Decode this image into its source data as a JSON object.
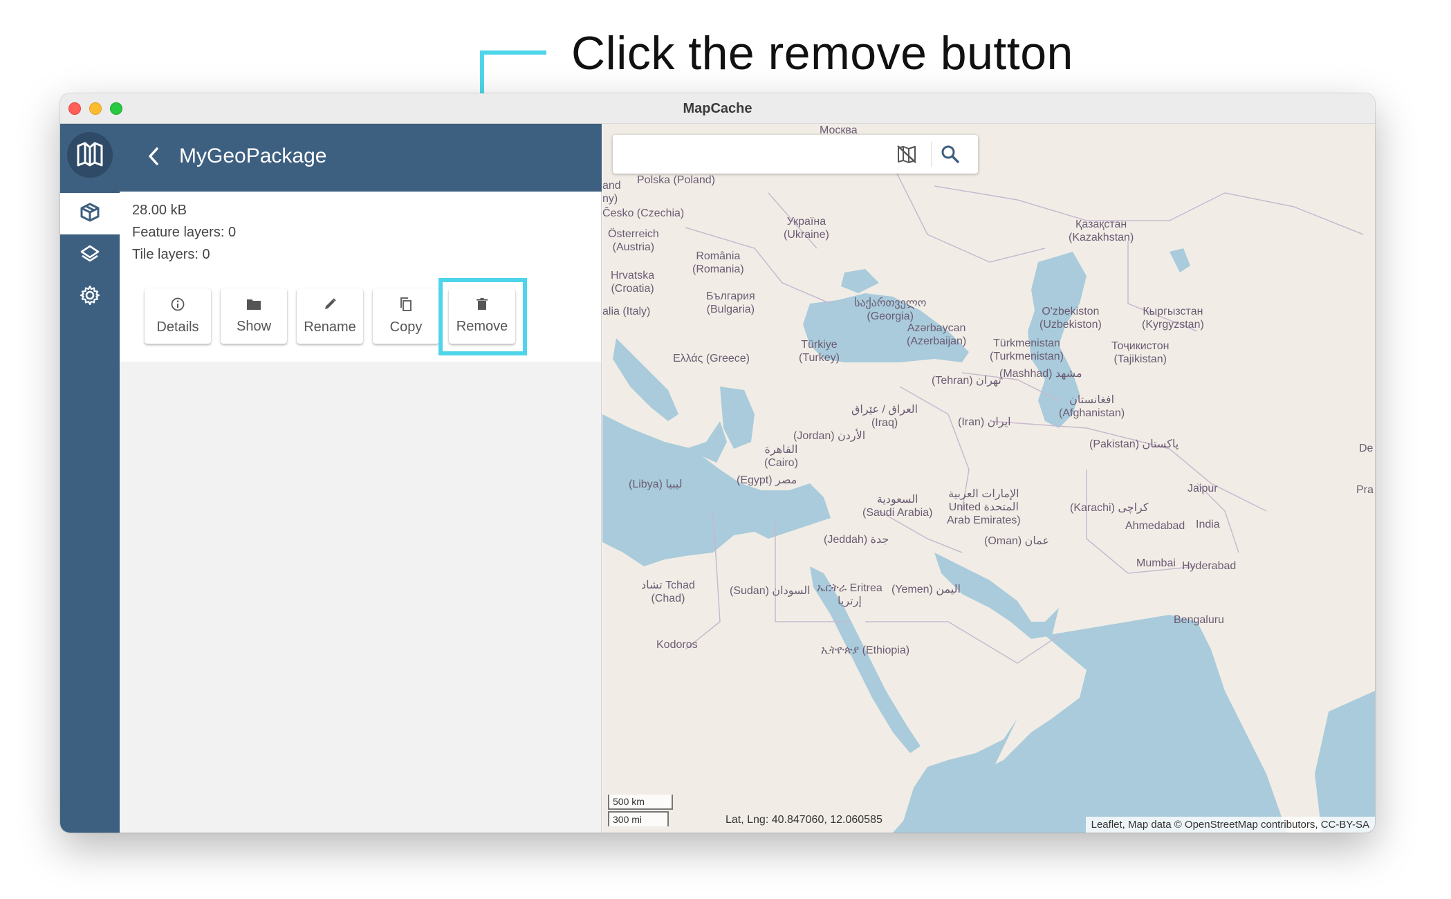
{
  "annotation": {
    "text": "Click the remove button"
  },
  "window": {
    "title": "MapCache"
  },
  "panel": {
    "title": "MyGeoPackage",
    "size": "28.00 kB",
    "feature_layers": "Feature layers: 0",
    "tile_layers": "Tile layers: 0",
    "actions": [
      {
        "label": "Details",
        "icon": "info-icon"
      },
      {
        "label": "Show",
        "icon": "folder-icon"
      },
      {
        "label": "Rename",
        "icon": "pencil-icon"
      },
      {
        "label": "Copy",
        "icon": "copy-icon"
      },
      {
        "label": "Remove",
        "icon": "trash-icon"
      }
    ]
  },
  "rail": {
    "items": [
      "geopackage-icon",
      "layers-icon",
      "settings-icon"
    ]
  },
  "map": {
    "search_placeholder": "",
    "zoom_level": "4",
    "scale_km": "500 km",
    "scale_mi": "300 mi",
    "latlng": "Lat, Lng: 40.847060, 12.060585",
    "attribution": "Leaflet, Map data © OpenStreetMap contributors, CC-BY-SA",
    "labels": [
      "Москва",
      "Polska (Poland)",
      "Česko (Czechia)",
      "Україна\n(Ukraine)",
      "Österreich\n(Austria)",
      "România\n(Romania)",
      "Hrvatska\n(Croatia)",
      "България\n(Bulgaria)",
      "alia (Italy)",
      "Қазақстан\n(Kazakhstan)",
      "საქართველო\n(Georgia)",
      "Azərbaycan\n(Azerbaijan)",
      "O'zbekiston\n(Uzbekiston)",
      "Кыргызстан\n(Kyrgyzstan)",
      "Türkmenistan\n(Turkmenistan)",
      "Тоҷикистон\n(Tajikistan)",
      "Türkiye\n(Turkey)",
      "Ελλάς (Greece)",
      "(Mashhad) مشهد",
      "(Tehran) تهران",
      "افغانستان\n(Afghanistan)",
      "العراق / عێراق\n(Iraq)",
      "(Iran) ایران",
      "(Jordan) الأردن",
      "القاهرة\n(Cairo)",
      "(Pakistan) پاکستان",
      "(Libya) ليبيا",
      "(Egypt) مصر",
      "السعودية\n(Saudi Arabia)",
      "الإمارات العربية\nUnited المتحدة\nArab Emirates)",
      "(Karachi) کراچی",
      "Jaipur",
      "Ahmedabad",
      "India",
      "(Jeddah) جدة",
      "(Oman) عمان",
      "Mumbai",
      "Hyderabad",
      "تشاد Tchad\n(Chad)",
      "(Sudan) السودان",
      "ኤርትራ Eritrea\nإرتريا",
      "(Yemen) اليمن",
      "Bengaluru",
      "ኢትዮጵያ (Ethiopia)",
      "Kodoros",
      "and\nny)",
      "Pra",
      "De"
    ]
  },
  "fab": {
    "icon": "add-layer-icon"
  }
}
